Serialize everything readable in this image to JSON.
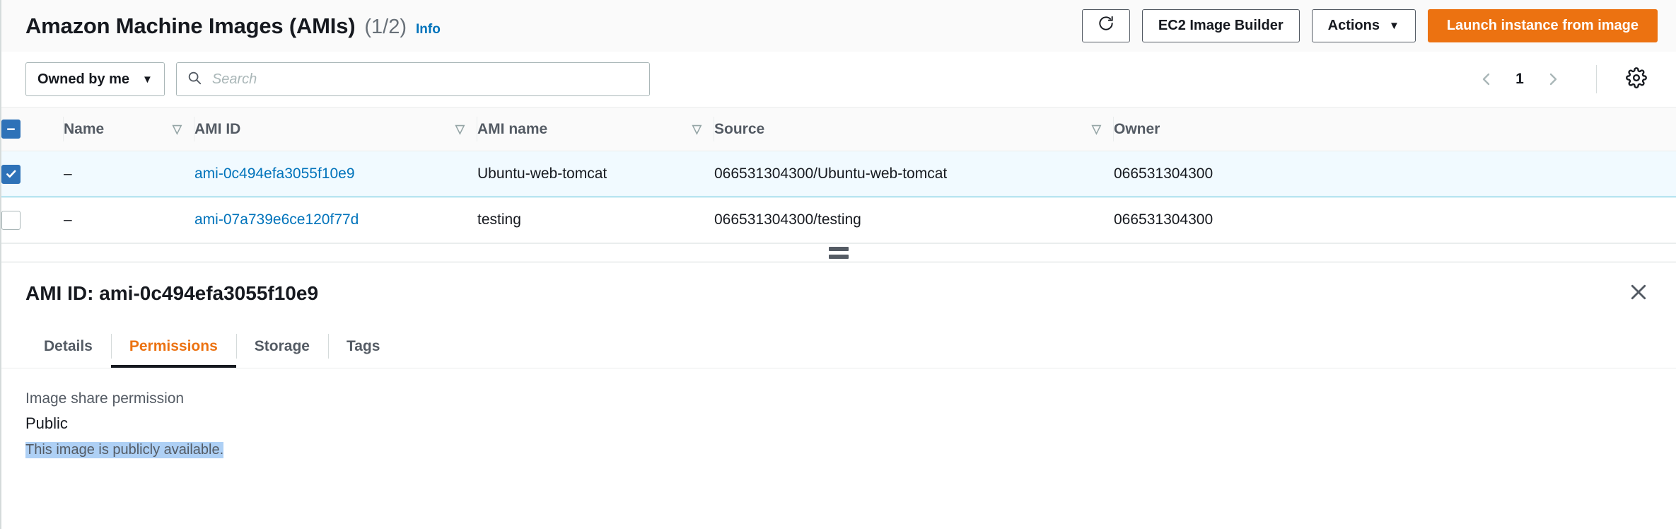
{
  "header": {
    "title": "Amazon Machine Images (AMIs)",
    "count": "(1/2)",
    "info_link": "Info",
    "refresh_icon": "refresh-icon",
    "image_builder_button": "EC2 Image Builder",
    "actions_button": "Actions",
    "actions_caret": "▼",
    "launch_button": "Launch instance from image"
  },
  "filters": {
    "owner_select": "Owned by me",
    "owner_caret": "▼",
    "search_placeholder": "Search",
    "search_value": "",
    "search_icon": "search-icon",
    "prev_page_icon": "chevron-left-icon",
    "page_number": "1",
    "next_page_icon": "chevron-right-icon",
    "settings_icon": "gear-icon"
  },
  "table": {
    "select_all_state": "indeterminate",
    "columns": [
      {
        "label": "Name",
        "sortable": true
      },
      {
        "label": "AMI ID",
        "sortable": true
      },
      {
        "label": "AMI name",
        "sortable": true
      },
      {
        "label": "Source",
        "sortable": true
      },
      {
        "label": "Owner",
        "sortable": false
      }
    ],
    "rows": [
      {
        "selected": true,
        "name": "–",
        "ami_id": "ami-0c494efa3055f10e9",
        "ami_name": "Ubuntu-web-tomcat",
        "source": "066531304300/Ubuntu-web-tomcat",
        "owner": "066531304300"
      },
      {
        "selected": false,
        "name": "–",
        "ami_id": "ami-07a739e6ce120f77d",
        "ami_name": "testing",
        "source": "066531304300/testing",
        "owner": "066531304300"
      }
    ]
  },
  "splitter": {
    "handle_icon": "drag-handle-icon"
  },
  "detail": {
    "title": "AMI ID: ami-0c494efa3055f10e9",
    "close_icon": "close-icon",
    "tabs": [
      {
        "label": "Details",
        "active": false
      },
      {
        "label": "Permissions",
        "active": true
      },
      {
        "label": "Storage",
        "active": false
      },
      {
        "label": "Tags",
        "active": false
      }
    ],
    "permissions": {
      "share_label": "Image share permission",
      "share_value": "Public",
      "note": "This image is publicly available."
    }
  },
  "colors": {
    "accent_orange": "#ec7211",
    "link_blue": "#0073bb",
    "checkbox_blue": "#2e72b8",
    "selected_row_bg": "#f1faff",
    "selection_highlight": "#aed0f5"
  }
}
